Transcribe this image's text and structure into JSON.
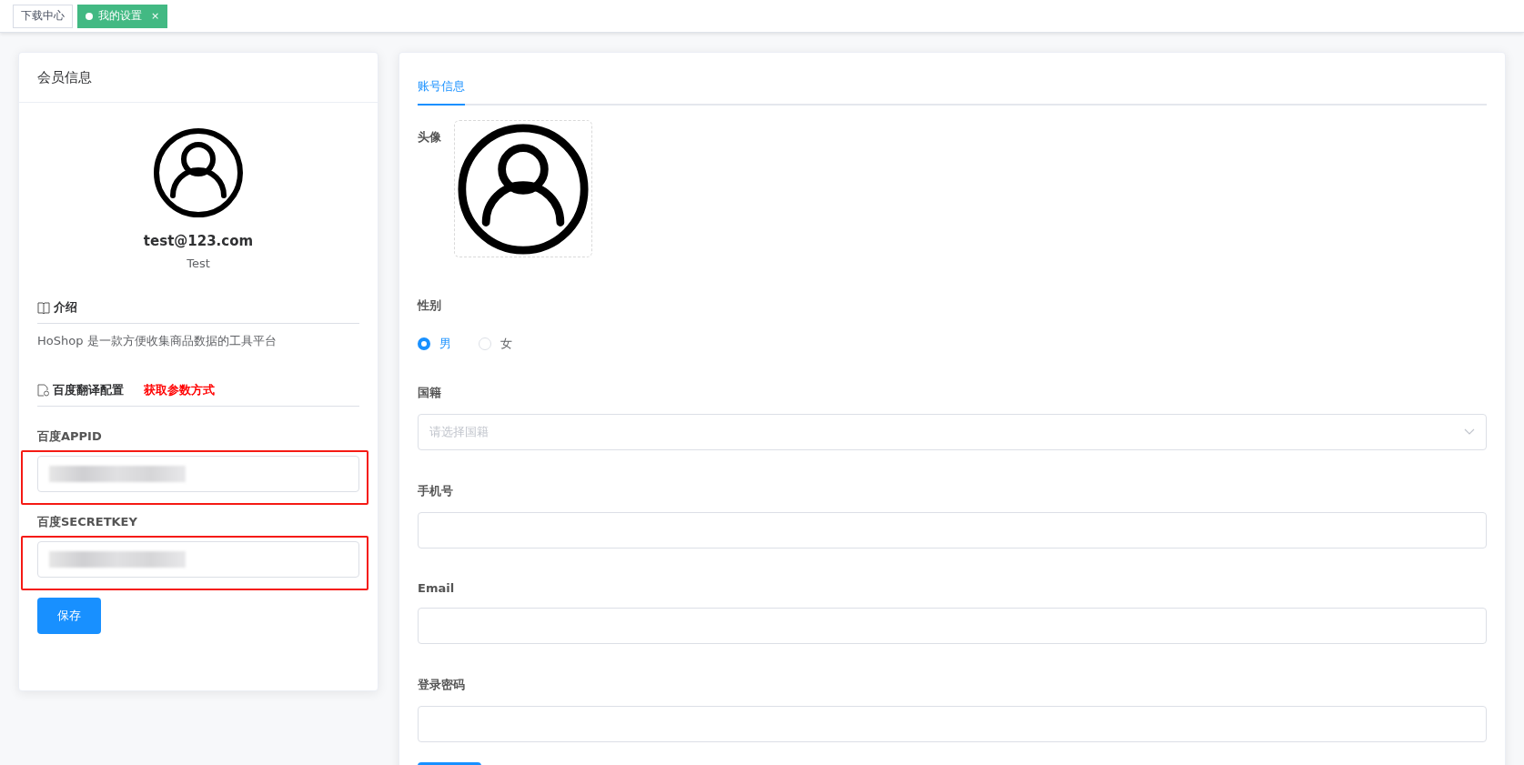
{
  "tabs": [
    {
      "label": "下载中心",
      "selected": false,
      "closable": false
    },
    {
      "label": "我的设置",
      "selected": true,
      "closable": true,
      "close": "×"
    }
  ],
  "profile_card": {
    "title": "会员信息",
    "email": "test@123.com",
    "name": "Test",
    "intro_heading": "介绍",
    "intro_text": "HoShop 是一款方便收集商品数据的工具平台",
    "translate_heading": "百度翻译配置",
    "translate_link": "获取参数方式",
    "fields": [
      {
        "label": "百度APPID",
        "highlighted": true
      },
      {
        "label": "百度SECRETKEY",
        "highlighted": true
      }
    ],
    "save_button": "保存"
  },
  "account_card": {
    "tabs": [
      {
        "label": "账号信息",
        "selected": true
      }
    ],
    "avatar_label": "头像",
    "gender": {
      "label": "性别",
      "options": [
        {
          "label": "男",
          "selected": true
        },
        {
          "label": "女",
          "selected": false
        }
      ]
    },
    "nationality": {
      "label": "国籍",
      "placeholder": "请选择国籍"
    },
    "fields": [
      {
        "label": "手机号"
      },
      {
        "label": "Email"
      },
      {
        "label": "登录密码"
      }
    ]
  }
}
